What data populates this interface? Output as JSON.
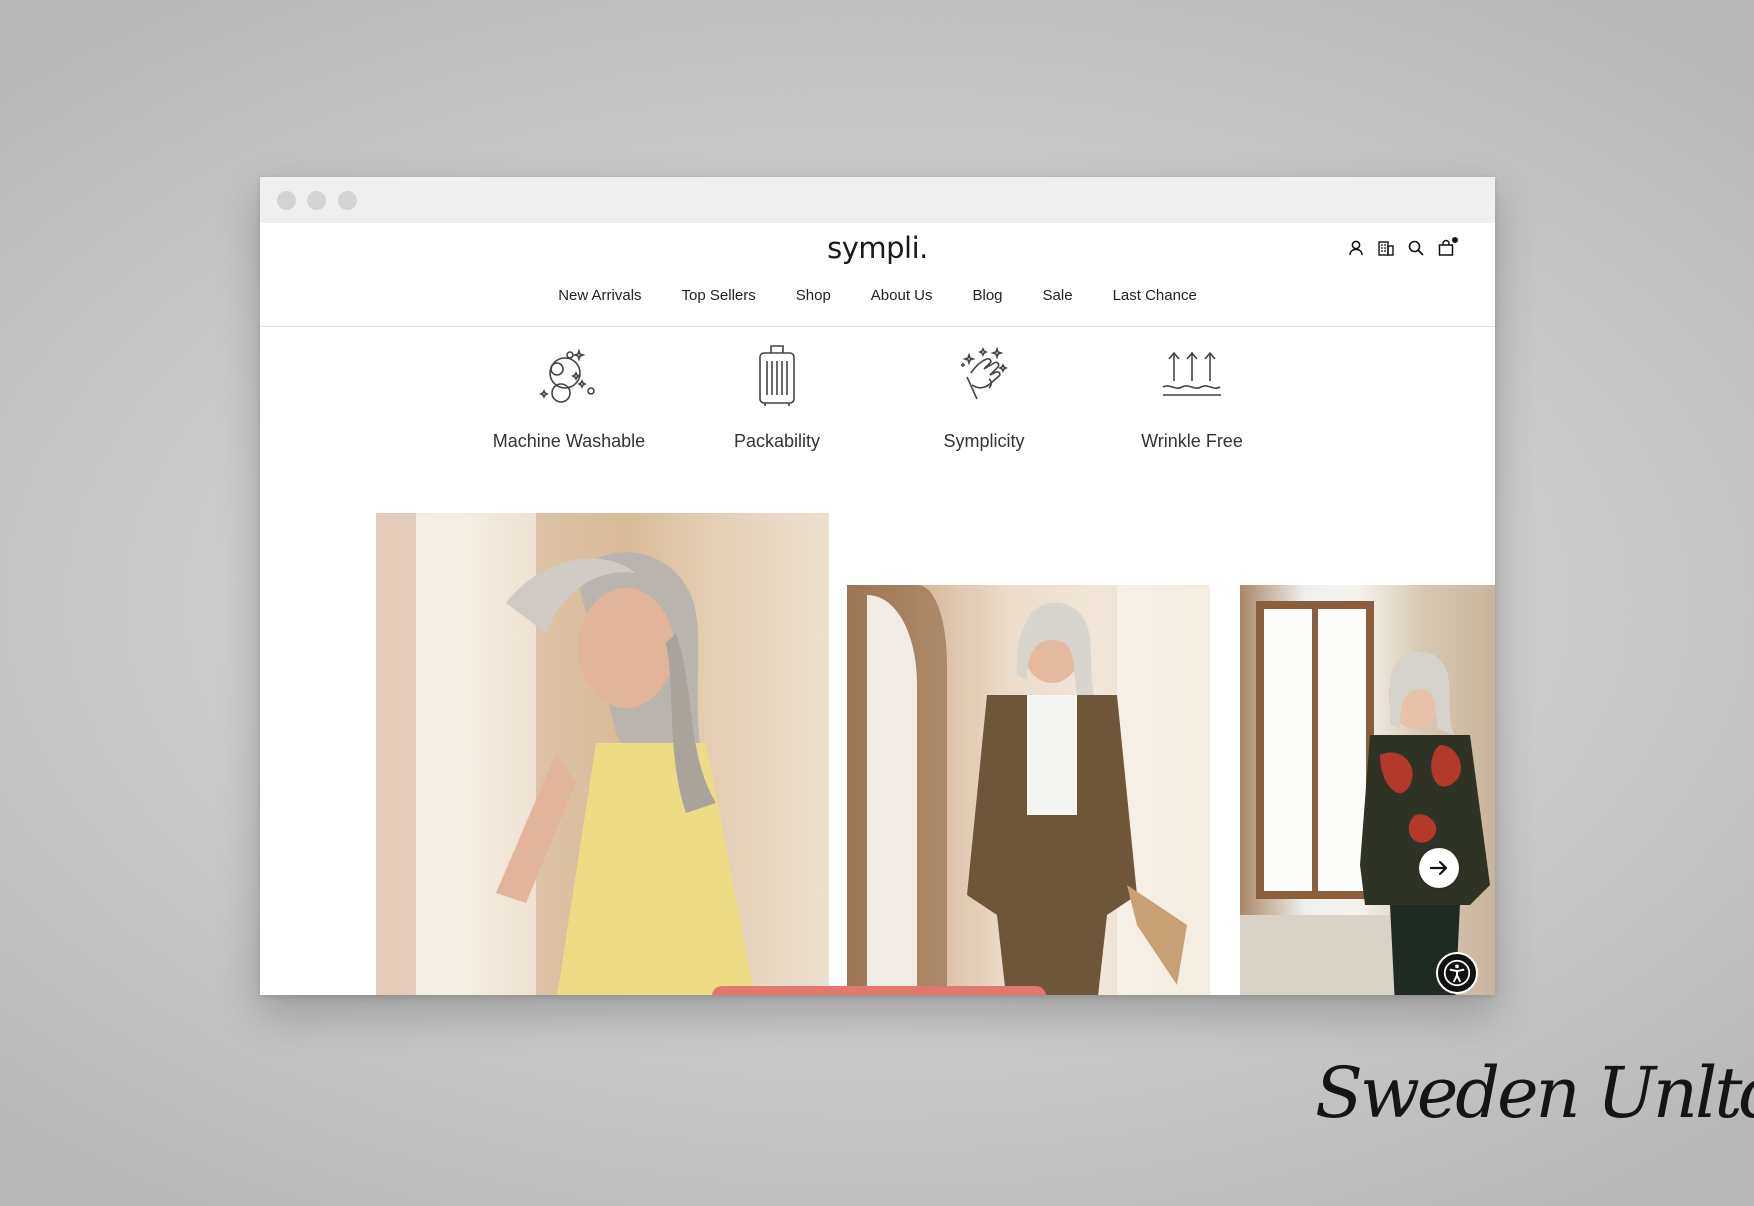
{
  "site": {
    "logo": "sympli."
  },
  "header_icons": [
    "account-icon",
    "store-locator-icon",
    "search-icon",
    "cart-icon"
  ],
  "nav": {
    "items": [
      "New Arrivals",
      "Top Sellers",
      "Shop",
      "About Us",
      "Blog",
      "Sale",
      "Last Chance"
    ]
  },
  "features": [
    {
      "label": "Machine Washable",
      "icon": "washing-bubbles-icon"
    },
    {
      "label": "Packability",
      "icon": "suitcase-icon"
    },
    {
      "label": "Symplicity",
      "icon": "snapping-hand-icon"
    },
    {
      "label": "Wrinkle Free",
      "icon": "wrinkle-free-arrows-icon"
    }
  ],
  "gallery": {
    "photos": [
      "woman-in-yellow-sleeveless-top-photo",
      "woman-in-olive-shirt-jacket-photo",
      "woman-in-floral-print-top-photo"
    ],
    "next_icon": "arrow-right-icon"
  },
  "accessibility_icon": "accessibility-person-icon",
  "watermark": "Sweden Unltd",
  "colors": {
    "cta": "#e4776d",
    "text": "#222222",
    "titlebar": "#efefef"
  }
}
